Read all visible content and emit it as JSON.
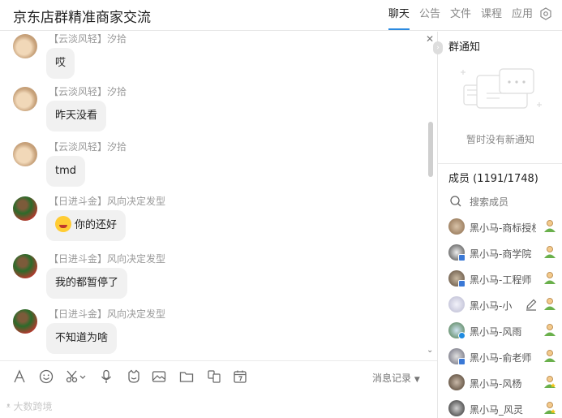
{
  "header": {
    "title": "京东店群精准商家交流",
    "tabs": [
      "聊天",
      "公告",
      "文件",
      "课程",
      "应用"
    ],
    "active_tab": "聊天"
  },
  "chat": {
    "messages": [
      {
        "sender": "【云淡风轻】汐拾",
        "text": "哎"
      },
      {
        "sender": "【云淡风轻】汐拾",
        "text": "昨天没看"
      },
      {
        "sender": "【云淡风轻】汐拾",
        "text": "tmd"
      },
      {
        "sender": "【日进斗金】风向决定发型",
        "text": "你的还好",
        "emoji": "laugh-cry-emoji"
      },
      {
        "sender": "【日进斗金】风向决定发型",
        "text": "我的都暂停了"
      },
      {
        "sender": "【日进斗金】风向决定发型",
        "text": "不知道为啥"
      }
    ]
  },
  "toolbar": {
    "history_label": "消息记录",
    "icons": [
      "font-icon",
      "emoji-icon",
      "scissors-icon",
      "microphone-icon",
      "sticker-icon",
      "image-icon",
      "folder-icon",
      "doc-icon",
      "calendar-icon"
    ]
  },
  "watermark": "大数跨境",
  "panel": {
    "notice_title": "群通知",
    "notice_empty": "暂时没有新通知",
    "members_title": "成员 (1191/1748)",
    "search_placeholder": "搜索成员",
    "members": [
      {
        "name": "黑小马-商标授权"
      },
      {
        "name": "黑小马-商学院"
      },
      {
        "name": "黑小马-工程师"
      },
      {
        "name": "黑小马-小"
      },
      {
        "name": "黑小马-风雨"
      },
      {
        "name": "黑小马-俞老师"
      },
      {
        "name": "黑小马-风杨"
      },
      {
        "name": "黑小马_风灵"
      }
    ]
  },
  "colors": {
    "accent": "#2b8ae0",
    "bubble": "#f1f1f1",
    "member_role": "#6ab04c"
  }
}
